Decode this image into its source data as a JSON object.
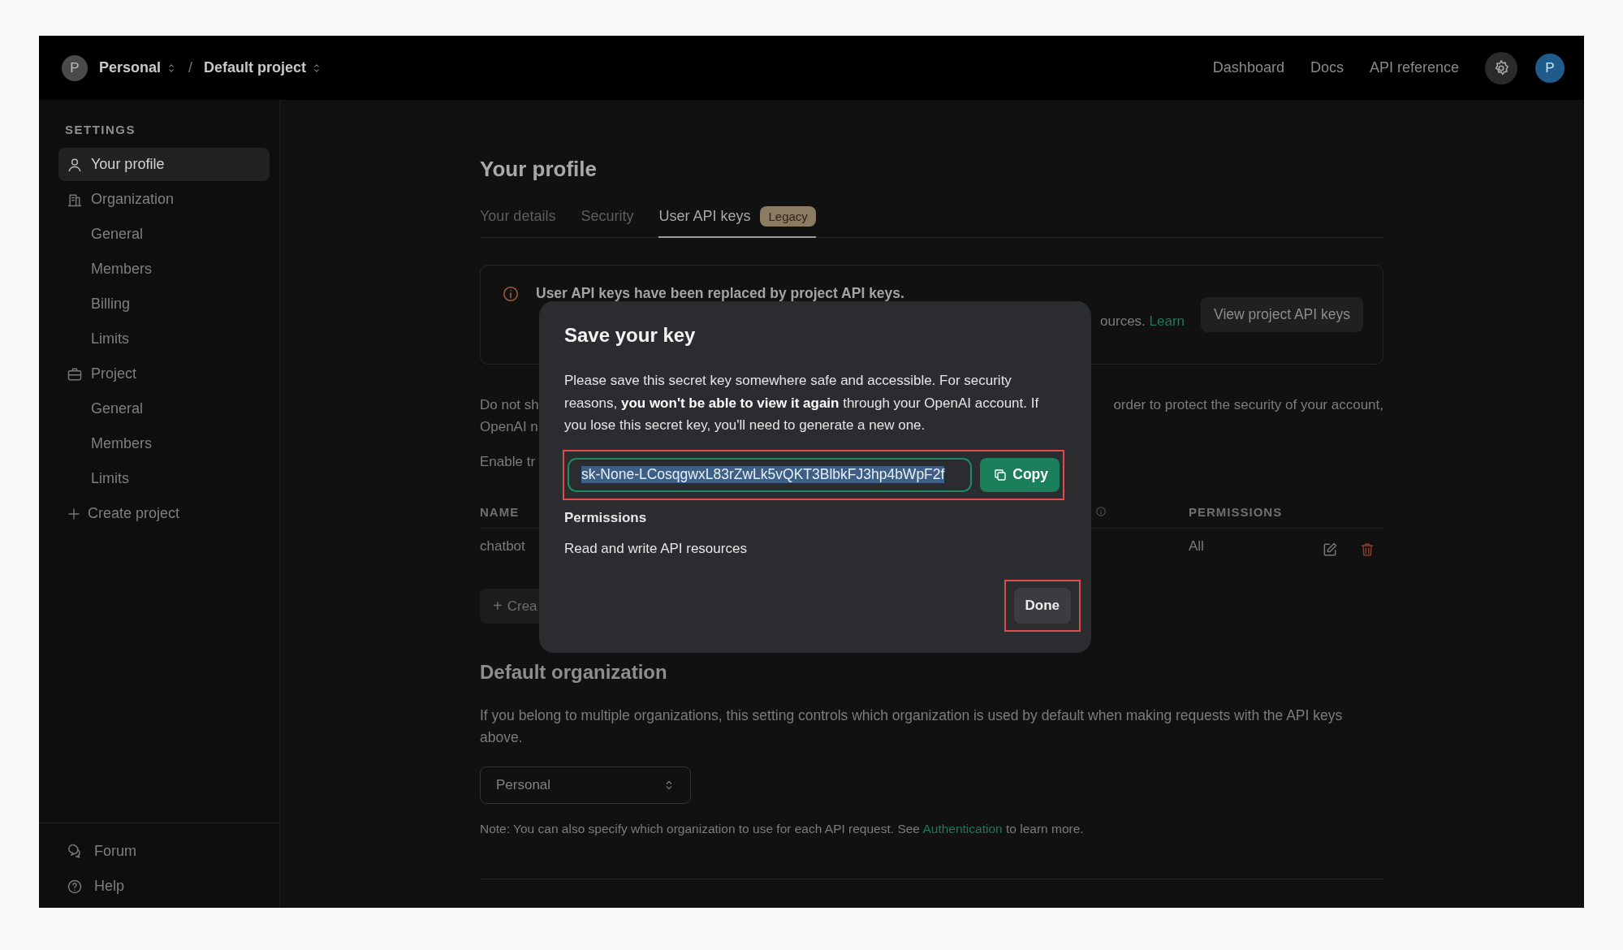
{
  "topbar": {
    "avatar": "P",
    "crumbs": [
      {
        "label": "Personal"
      },
      {
        "label": "Default project"
      }
    ],
    "separator": "/",
    "links": [
      "Dashboard",
      "Docs",
      "API reference"
    ],
    "user_avatar": "P"
  },
  "sidebar": {
    "heading": "SETTINGS",
    "items": [
      {
        "label": "Your profile",
        "kind": "section",
        "selected": true
      },
      {
        "label": "Organization",
        "kind": "section",
        "selected": false
      },
      {
        "label": "General",
        "kind": "sub",
        "selected": false
      },
      {
        "label": "Members",
        "kind": "sub",
        "selected": false
      },
      {
        "label": "Billing",
        "kind": "sub",
        "selected": false
      },
      {
        "label": "Limits",
        "kind": "sub",
        "selected": false
      },
      {
        "label": "Project",
        "kind": "section",
        "selected": false
      },
      {
        "label": "General",
        "kind": "sub",
        "selected": false
      },
      {
        "label": "Members",
        "kind": "sub",
        "selected": false
      },
      {
        "label": "Limits",
        "kind": "sub",
        "selected": false
      },
      {
        "label": "Create project",
        "kind": "add",
        "selected": false
      }
    ],
    "footer": [
      {
        "label": "Forum"
      },
      {
        "label": "Help"
      }
    ]
  },
  "page": {
    "title": "Your profile",
    "tabs": [
      {
        "label": "Your details",
        "selected": false
      },
      {
        "label": "Security",
        "selected": false
      },
      {
        "label": "User API keys",
        "selected": true,
        "badge": "Legacy"
      }
    ],
    "notice": {
      "title": "User API keys have been replaced by project API keys.",
      "right": "ources.",
      "link": "Learn",
      "button": "View project API keys"
    },
    "fragments": [
      {
        "left": "Do not sh",
        "right": "order to protect the security of your account,"
      },
      {
        "left": "OpenAI n"
      },
      {
        "left": "Enable tr"
      }
    ],
    "table": {
      "columns": [
        "NAME",
        "PERMISSIONS"
      ],
      "rows": [
        {
          "name": "chatbot",
          "permissions": "All"
        }
      ]
    },
    "create_button": {
      "icon": "+",
      "label": "Crea"
    },
    "default_org": {
      "title": "Default organization",
      "description": "If you belong to multiple organizations, this setting controls which organization is used by default when making requests with the API keys above.",
      "select": "Personal",
      "note_before": "Note: You can also specify which organization to use for each API request. See",
      "note_link": "Authentication",
      "note_after": "to learn more."
    }
  },
  "modal": {
    "title": "Save your key",
    "description": "Please save this secret key somewhere safe and accessible. For security reasons, **you won't be able to view it again** through your OpenAI account. If you lose this secret key, you'll need to generate a new one.",
    "key": "sk-None-LCosqgwxL83rZwLk5vQKT3BlbkFJ3hp4bWpF2f",
    "key_selected": true,
    "key_highlighted": true,
    "copy_button": "Copy",
    "permissions_label": "Permissions",
    "permissions": "Read and write API resources",
    "done_button": "Done",
    "done_highlighted": true
  }
}
